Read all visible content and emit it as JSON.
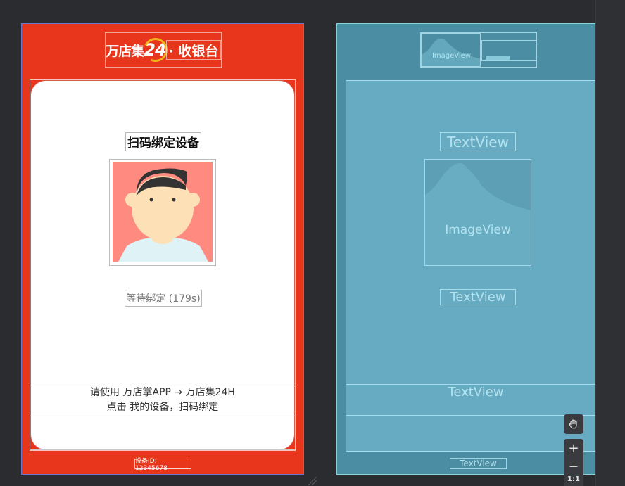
{
  "design": {
    "logo_brand": "万店集",
    "logo_number": "24",
    "logo_title": "· 收银台",
    "scan_title": "扫码绑定设备",
    "wait_text": "等待绑定 (179s)",
    "instruction_line1": "请使用 万店掌APP → 万店集24H",
    "instruction_line2": "点击 我的设备，扫码绑定",
    "device_id": "设备ID: 12345678",
    "colors": {
      "background": "#e8361c",
      "card": "#ffffff",
      "avatar_bg": "#ff8a80",
      "logo_accent": "#f0b51b"
    }
  },
  "blueprint": {
    "logo_image_label": "ImageView",
    "title_label": "TextView",
    "image_label": "ImageView",
    "wait_label": "TextView",
    "instruction_label": "TextView",
    "device_label": "TextView",
    "colors": {
      "background": "#4b8ea3",
      "card": "#67abc2"
    }
  },
  "tools": {
    "pan_icon": "hand-icon",
    "zoom_in": "+",
    "zoom_out": "—",
    "actual_size": "1:1"
  }
}
